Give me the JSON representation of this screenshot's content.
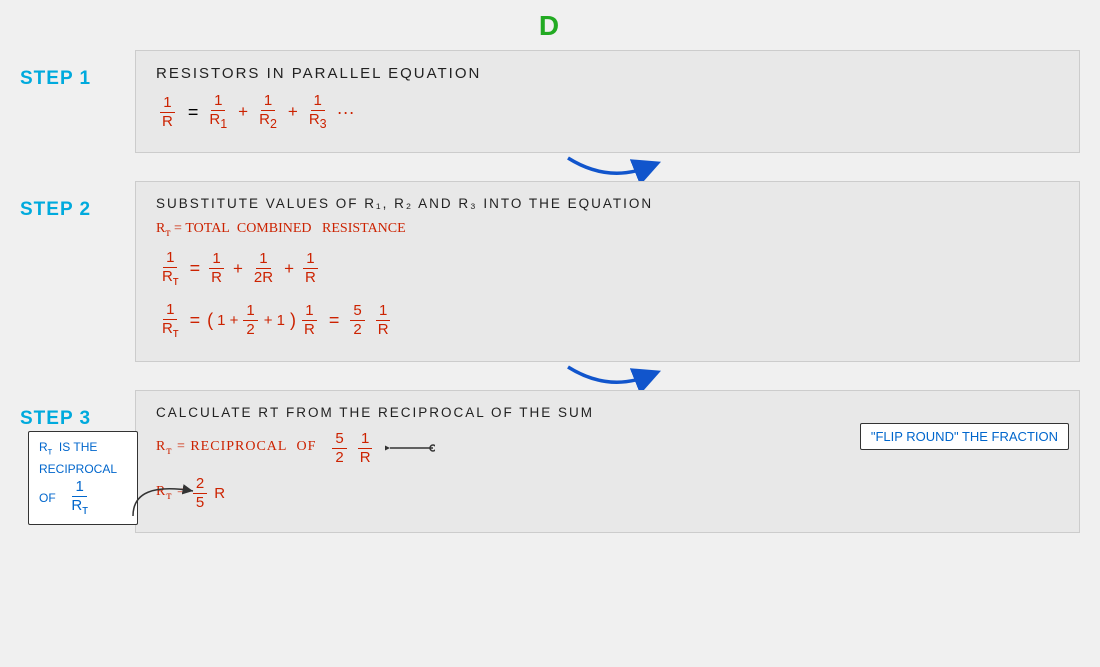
{
  "title": "D",
  "steps": [
    {
      "label": "STEP  1",
      "box_title": "RESISTORS  IN  PARALLEL   EQUATION",
      "formula_description": "1/R = 1/R1 + 1/R2 + 1/R3 ..."
    },
    {
      "label": "STEP  2",
      "box_title": "SUBSTITUTE  VALUES  OF  R₁,  R₂  AND  R₃  INTO  THE  EQUATION",
      "sub_label": "Rт = TOTAL  COMBINED   RESISTANCE"
    },
    {
      "label": "STEP  3",
      "box_title": "CALCULATE  Rт  FROM  THE  RECIPROCAL  OF  THE  SUM",
      "annotation_left": "Rт  IS THE\nRECIPROCAL\nOF  1\n    Rт",
      "annotation_right": "\"FLIP  ROUND\"  THE  FRACTION"
    }
  ],
  "colors": {
    "step_label": "#00aadd",
    "title": "#22aa22",
    "red": "#cc2200",
    "blue": "#0066cc",
    "box_bg": "#e8e8e8"
  }
}
